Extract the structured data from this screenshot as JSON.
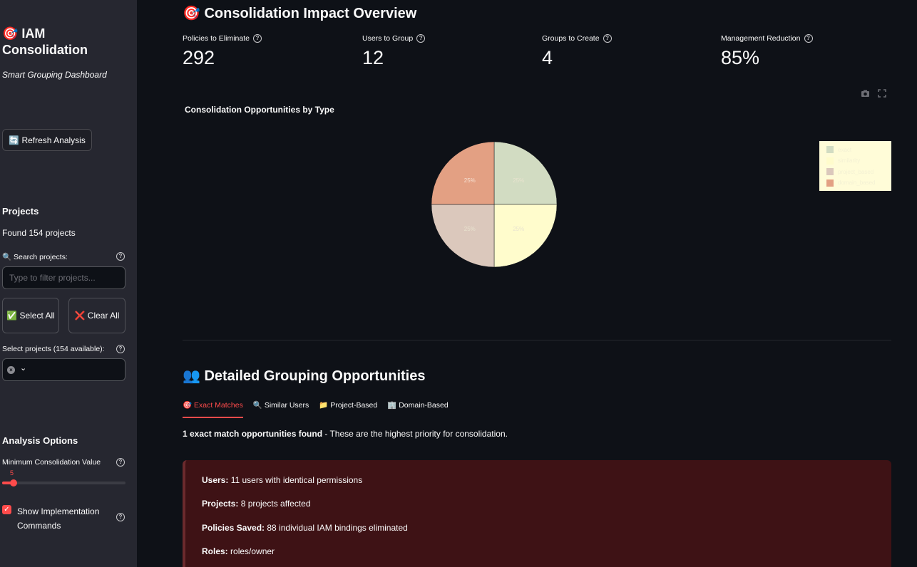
{
  "sidebar": {
    "title": "🎯 IAM Consolidation",
    "subtitle": "Smart Grouping Dashboard",
    "refresh_button": "🔄 Refresh Analysis",
    "projects_heading": "Projects",
    "found_text": "Found 154 projects",
    "search_label": "🔍 Search projects:",
    "search_placeholder": "Type to filter projects...",
    "select_all": "✅ Select All",
    "clear_all": "❌ Clear All",
    "select_label": "Select projects (154 available):",
    "analysis_heading": "Analysis Options",
    "min_value_label": "Minimum Consolidation Value",
    "min_value": "5",
    "min_value_fraction": 0.05,
    "show_commands_label": "Show Implementation Commands",
    "show_commands_checked": true
  },
  "overview": {
    "heading": "🎯 Consolidation Impact Overview",
    "metrics": [
      {
        "label": "Policies to Eliminate",
        "value": "292"
      },
      {
        "label": "Users to Group",
        "value": "12"
      },
      {
        "label": "Groups to Create",
        "value": "4"
      },
      {
        "label": "Management Reduction",
        "value": "85%"
      }
    ]
  },
  "chart_data": {
    "type": "pie",
    "title": "Consolidation Opportunities by Type",
    "categories": [
      "exact",
      "similarity",
      "project_based",
      "domain_based"
    ],
    "values": [
      25,
      25,
      25,
      25
    ],
    "colors": [
      "#d2dcc2",
      "#fffccc",
      "#dbc8bc",
      "#e3a083"
    ],
    "slice_labels": [
      "25%",
      "25%",
      "25%",
      "25%"
    ],
    "legend_position": "top-right"
  },
  "details": {
    "heading": "👥 Detailed Grouping Opportunities",
    "tabs": [
      "🎯 Exact Matches",
      "🔍 Similar Users",
      "📁 Project-Based",
      "🏢 Domain-Based"
    ],
    "active_tab": 0,
    "summary_bold": "1 exact match opportunities found",
    "summary_rest": " - These are the highest priority for consolidation.",
    "card": {
      "users_label": "Users:",
      "users_value": " 11 users with identical permissions",
      "projects_label": "Projects:",
      "projects_value": " 8 projects affected",
      "policies_label": "Policies Saved:",
      "policies_value": " 88 individual IAM bindings eliminated",
      "roles_label": "Roles:",
      "roles_value": " roles/owner"
    }
  },
  "colors": {
    "accent": "#ff4b4b",
    "background": "#0e1117",
    "sidebar": "#262730",
    "card": "#3e1215"
  },
  "icons": [
    "help-icon",
    "camera-icon",
    "fullscreen-icon",
    "chevron-down-icon",
    "clear-icon"
  ]
}
